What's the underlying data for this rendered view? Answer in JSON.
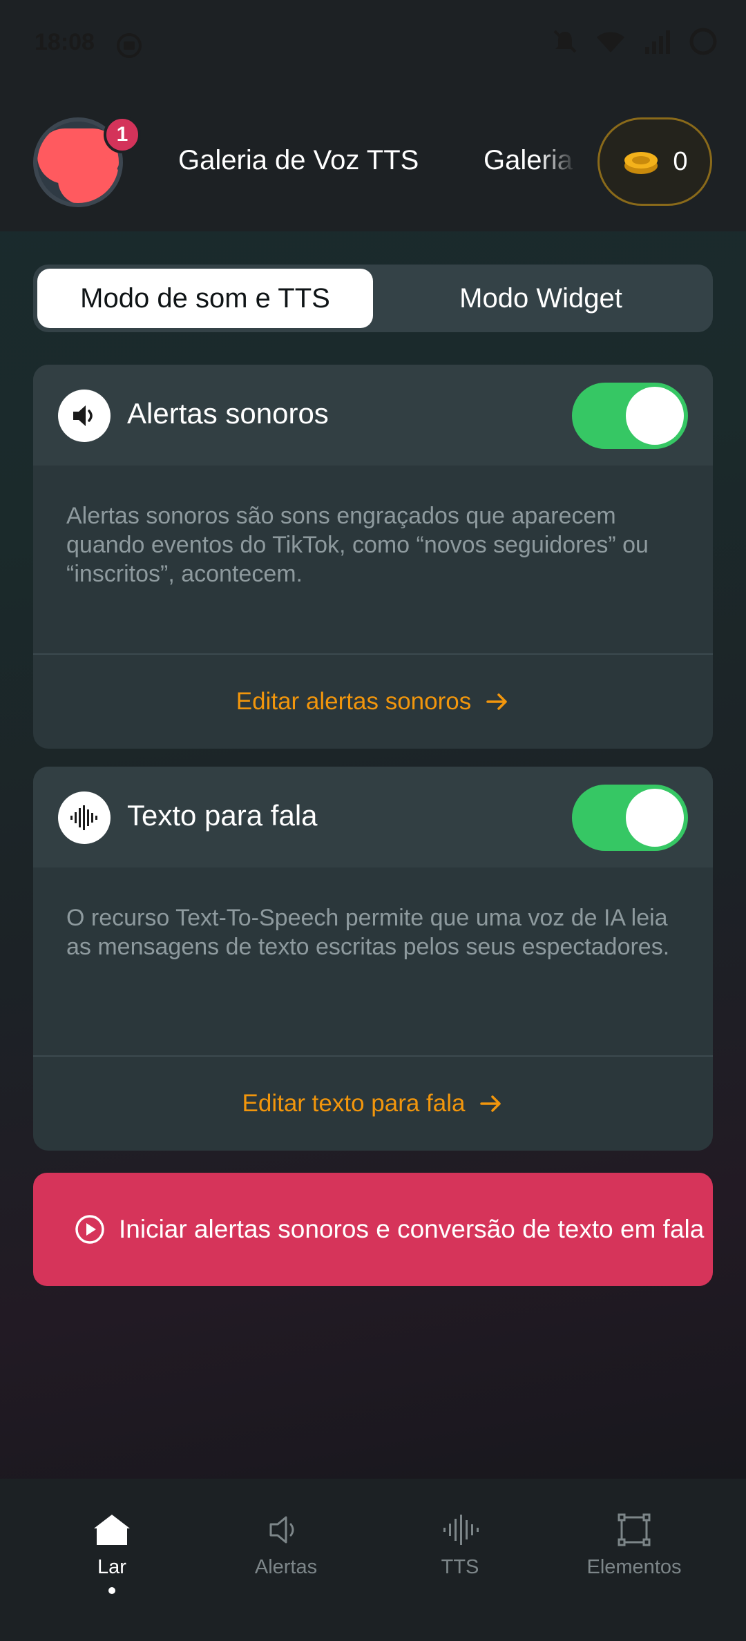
{
  "status_bar": {
    "time": "18:08",
    "icons": [
      "media-icon",
      "bell-muted-icon",
      "wifi-icon",
      "signal-icon",
      "battery-ring-icon"
    ]
  },
  "header": {
    "badge_count": "1",
    "tabs": [
      {
        "label": "Galeria de Voz TTS"
      },
      {
        "label": "Galeria"
      }
    ],
    "coins": "0"
  },
  "mode_switch": {
    "active": "Modo de som e TTS",
    "inactive": "Modo Widget"
  },
  "cards": [
    {
      "title": "Alertas sonoros",
      "icon": "speaker-icon",
      "enabled": true,
      "description": "Alertas sonoros são sons engraçados que aparecem quando eventos do TikTok, como “novos seguidores” ou “inscritos”, acontecem.",
      "link": "Editar alertas sonoros"
    },
    {
      "title": "Texto para fala",
      "icon": "waveform-icon",
      "enabled": true,
      "description": "O recurso Text-To-Speech permite que uma voz de IA leia as mensagens de texto escritas pelos seus espectadores.",
      "link": "Editar texto para fala"
    }
  ],
  "start_button": {
    "label": "Iniciar alertas sonoros e conversão de texto em fala"
  },
  "bottom_nav": [
    {
      "label": "Lar",
      "icon": "home-icon",
      "active": true
    },
    {
      "label": "Alertas",
      "icon": "speaker-outline-icon",
      "active": false
    },
    {
      "label": "TTS",
      "icon": "waveform-icon",
      "active": false
    },
    {
      "label": "Elementos",
      "icon": "elements-icon",
      "active": false
    }
  ],
  "colors": {
    "accent_orange": "#f2960c",
    "toggle_green": "#36c764",
    "start_red": "#d6345a",
    "badge_red": "#d4335a"
  }
}
